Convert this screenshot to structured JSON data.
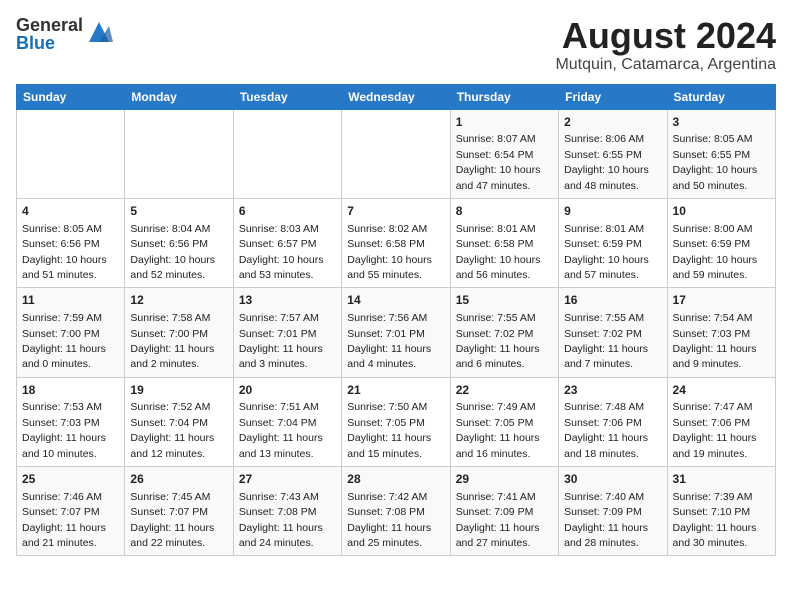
{
  "header": {
    "logo_general": "General",
    "logo_blue": "Blue",
    "title": "August 2024",
    "subtitle": "Mutquin, Catamarca, Argentina"
  },
  "weekdays": [
    "Sunday",
    "Monday",
    "Tuesday",
    "Wednesday",
    "Thursday",
    "Friday",
    "Saturday"
  ],
  "weeks": [
    [
      {
        "day": "",
        "info": ""
      },
      {
        "day": "",
        "info": ""
      },
      {
        "day": "",
        "info": ""
      },
      {
        "day": "",
        "info": ""
      },
      {
        "day": "1",
        "info": "Sunrise: 8:07 AM\nSunset: 6:54 PM\nDaylight: 10 hours\nand 47 minutes."
      },
      {
        "day": "2",
        "info": "Sunrise: 8:06 AM\nSunset: 6:55 PM\nDaylight: 10 hours\nand 48 minutes."
      },
      {
        "day": "3",
        "info": "Sunrise: 8:05 AM\nSunset: 6:55 PM\nDaylight: 10 hours\nand 50 minutes."
      }
    ],
    [
      {
        "day": "4",
        "info": "Sunrise: 8:05 AM\nSunset: 6:56 PM\nDaylight: 10 hours\nand 51 minutes."
      },
      {
        "day": "5",
        "info": "Sunrise: 8:04 AM\nSunset: 6:56 PM\nDaylight: 10 hours\nand 52 minutes."
      },
      {
        "day": "6",
        "info": "Sunrise: 8:03 AM\nSunset: 6:57 PM\nDaylight: 10 hours\nand 53 minutes."
      },
      {
        "day": "7",
        "info": "Sunrise: 8:02 AM\nSunset: 6:58 PM\nDaylight: 10 hours\nand 55 minutes."
      },
      {
        "day": "8",
        "info": "Sunrise: 8:01 AM\nSunset: 6:58 PM\nDaylight: 10 hours\nand 56 minutes."
      },
      {
        "day": "9",
        "info": "Sunrise: 8:01 AM\nSunset: 6:59 PM\nDaylight: 10 hours\nand 57 minutes."
      },
      {
        "day": "10",
        "info": "Sunrise: 8:00 AM\nSunset: 6:59 PM\nDaylight: 10 hours\nand 59 minutes."
      }
    ],
    [
      {
        "day": "11",
        "info": "Sunrise: 7:59 AM\nSunset: 7:00 PM\nDaylight: 11 hours\nand 0 minutes."
      },
      {
        "day": "12",
        "info": "Sunrise: 7:58 AM\nSunset: 7:00 PM\nDaylight: 11 hours\nand 2 minutes."
      },
      {
        "day": "13",
        "info": "Sunrise: 7:57 AM\nSunset: 7:01 PM\nDaylight: 11 hours\nand 3 minutes."
      },
      {
        "day": "14",
        "info": "Sunrise: 7:56 AM\nSunset: 7:01 PM\nDaylight: 11 hours\nand 4 minutes."
      },
      {
        "day": "15",
        "info": "Sunrise: 7:55 AM\nSunset: 7:02 PM\nDaylight: 11 hours\nand 6 minutes."
      },
      {
        "day": "16",
        "info": "Sunrise: 7:55 AM\nSunset: 7:02 PM\nDaylight: 11 hours\nand 7 minutes."
      },
      {
        "day": "17",
        "info": "Sunrise: 7:54 AM\nSunset: 7:03 PM\nDaylight: 11 hours\nand 9 minutes."
      }
    ],
    [
      {
        "day": "18",
        "info": "Sunrise: 7:53 AM\nSunset: 7:03 PM\nDaylight: 11 hours\nand 10 minutes."
      },
      {
        "day": "19",
        "info": "Sunrise: 7:52 AM\nSunset: 7:04 PM\nDaylight: 11 hours\nand 12 minutes."
      },
      {
        "day": "20",
        "info": "Sunrise: 7:51 AM\nSunset: 7:04 PM\nDaylight: 11 hours\nand 13 minutes."
      },
      {
        "day": "21",
        "info": "Sunrise: 7:50 AM\nSunset: 7:05 PM\nDaylight: 11 hours\nand 15 minutes."
      },
      {
        "day": "22",
        "info": "Sunrise: 7:49 AM\nSunset: 7:05 PM\nDaylight: 11 hours\nand 16 minutes."
      },
      {
        "day": "23",
        "info": "Sunrise: 7:48 AM\nSunset: 7:06 PM\nDaylight: 11 hours\nand 18 minutes."
      },
      {
        "day": "24",
        "info": "Sunrise: 7:47 AM\nSunset: 7:06 PM\nDaylight: 11 hours\nand 19 minutes."
      }
    ],
    [
      {
        "day": "25",
        "info": "Sunrise: 7:46 AM\nSunset: 7:07 PM\nDaylight: 11 hours\nand 21 minutes."
      },
      {
        "day": "26",
        "info": "Sunrise: 7:45 AM\nSunset: 7:07 PM\nDaylight: 11 hours\nand 22 minutes."
      },
      {
        "day": "27",
        "info": "Sunrise: 7:43 AM\nSunset: 7:08 PM\nDaylight: 11 hours\nand 24 minutes."
      },
      {
        "day": "28",
        "info": "Sunrise: 7:42 AM\nSunset: 7:08 PM\nDaylight: 11 hours\nand 25 minutes."
      },
      {
        "day": "29",
        "info": "Sunrise: 7:41 AM\nSunset: 7:09 PM\nDaylight: 11 hours\nand 27 minutes."
      },
      {
        "day": "30",
        "info": "Sunrise: 7:40 AM\nSunset: 7:09 PM\nDaylight: 11 hours\nand 28 minutes."
      },
      {
        "day": "31",
        "info": "Sunrise: 7:39 AM\nSunset: 7:10 PM\nDaylight: 11 hours\nand 30 minutes."
      }
    ]
  ]
}
